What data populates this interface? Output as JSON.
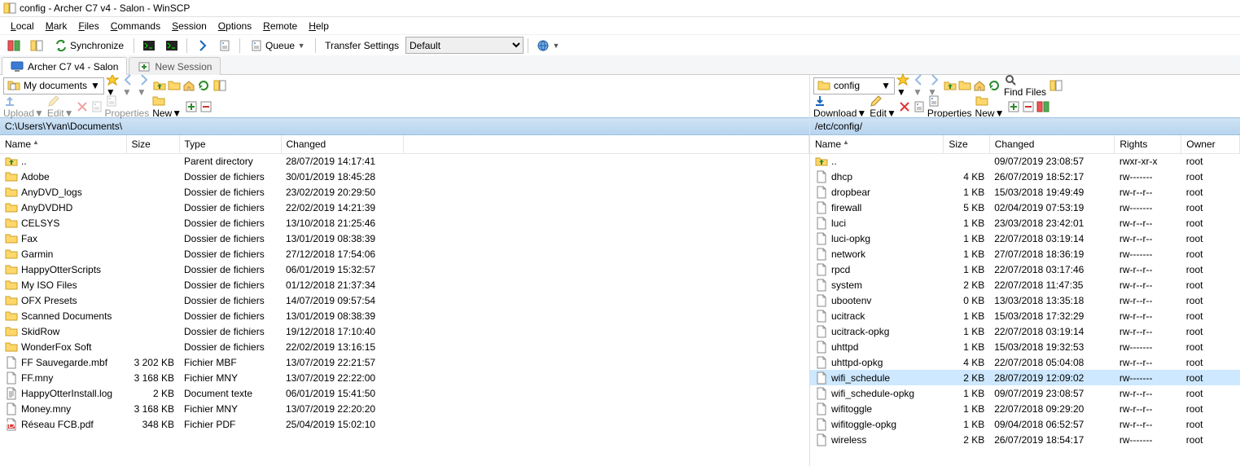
{
  "window_title": "config - Archer C7 v4 - Salon - WinSCP",
  "menu": [
    "Local",
    "Mark",
    "Files",
    "Commands",
    "Session",
    "Options",
    "Remote",
    "Help"
  ],
  "toolbar": {
    "synchronize": "Synchronize",
    "queue": "Queue",
    "transfer_label": "Transfer Settings",
    "transfer_value": "Default"
  },
  "tabs": {
    "session": "Archer C7 v4 - Salon",
    "new": "New Session"
  },
  "left": {
    "drive_label": "My documents",
    "actions": {
      "upload": "Upload",
      "edit": "Edit",
      "properties": "Properties",
      "new": "New"
    },
    "path": "C:\\Users\\Yvan\\Documents\\",
    "cols": [
      "Name",
      "Size",
      "Type",
      "Changed"
    ],
    "rows": [
      {
        "icon": "up",
        "name": "..",
        "size": "",
        "type": "Parent directory",
        "changed": "28/07/2019  14:17:41"
      },
      {
        "icon": "folder",
        "name": "Adobe",
        "size": "",
        "type": "Dossier de fichiers",
        "changed": "30/01/2019  18:45:28"
      },
      {
        "icon": "folder",
        "name": "AnyDVD_logs",
        "size": "",
        "type": "Dossier de fichiers",
        "changed": "23/02/2019  20:29:50"
      },
      {
        "icon": "folder",
        "name": "AnyDVDHD",
        "size": "",
        "type": "Dossier de fichiers",
        "changed": "22/02/2019  14:21:39"
      },
      {
        "icon": "folder",
        "name": "CELSYS",
        "size": "",
        "type": "Dossier de fichiers",
        "changed": "13/10/2018  21:25:46"
      },
      {
        "icon": "folder",
        "name": "Fax",
        "size": "",
        "type": "Dossier de fichiers",
        "changed": "13/01/2019  08:38:39"
      },
      {
        "icon": "folder",
        "name": "Garmin",
        "size": "",
        "type": "Dossier de fichiers",
        "changed": "27/12/2018  17:54:06"
      },
      {
        "icon": "folder",
        "name": "HappyOtterScripts",
        "size": "",
        "type": "Dossier de fichiers",
        "changed": "06/01/2019  15:32:57"
      },
      {
        "icon": "folder",
        "name": "My ISO Files",
        "size": "",
        "type": "Dossier de fichiers",
        "changed": "01/12/2018  21:37:34"
      },
      {
        "icon": "folder",
        "name": "OFX Presets",
        "size": "",
        "type": "Dossier de fichiers",
        "changed": "14/07/2019  09:57:54"
      },
      {
        "icon": "folder",
        "name": "Scanned Documents",
        "size": "",
        "type": "Dossier de fichiers",
        "changed": "13/01/2019  08:38:39"
      },
      {
        "icon": "folder",
        "name": "SkidRow",
        "size": "",
        "type": "Dossier de fichiers",
        "changed": "19/12/2018  17:10:40"
      },
      {
        "icon": "folder",
        "name": "WonderFox Soft",
        "size": "",
        "type": "Dossier de fichiers",
        "changed": "22/02/2019  13:16:15"
      },
      {
        "icon": "file",
        "name": "FF Sauvegarde.mbf",
        "size": "3 202 KB",
        "type": "Fichier MBF",
        "changed": "13/07/2019  22:21:57"
      },
      {
        "icon": "file",
        "name": "FF.mny",
        "size": "3 168 KB",
        "type": "Fichier MNY",
        "changed": "13/07/2019  22:22:00"
      },
      {
        "icon": "txt",
        "name": "HappyOtterInstall.log",
        "size": "2 KB",
        "type": "Document texte",
        "changed": "06/01/2019  15:41:50"
      },
      {
        "icon": "file",
        "name": "Money.mny",
        "size": "3 168 KB",
        "type": "Fichier MNY",
        "changed": "13/07/2019  22:20:20"
      },
      {
        "icon": "pdf",
        "name": "Réseau FCB.pdf",
        "size": "348 KB",
        "type": "Fichier PDF",
        "changed": "25/04/2019  15:02:10"
      }
    ]
  },
  "right": {
    "drive_label": "config",
    "find": "Find Files",
    "actions": {
      "download": "Download",
      "edit": "Edit",
      "properties": "Properties",
      "new": "New"
    },
    "path": "/etc/config/",
    "cols": [
      "Name",
      "Size",
      "Changed",
      "Rights",
      "Owner"
    ],
    "selected": "wifi_schedule",
    "rows": [
      {
        "icon": "up",
        "name": "..",
        "size": "",
        "changed": "09/07/2019 23:08:57",
        "rights": "rwxr-xr-x",
        "owner": "root"
      },
      {
        "icon": "file",
        "name": "dhcp",
        "size": "4 KB",
        "changed": "26/07/2019 18:52:17",
        "rights": "rw-------",
        "owner": "root"
      },
      {
        "icon": "file",
        "name": "dropbear",
        "size": "1 KB",
        "changed": "15/03/2018 19:49:49",
        "rights": "rw-r--r--",
        "owner": "root"
      },
      {
        "icon": "file",
        "name": "firewall",
        "size": "5 KB",
        "changed": "02/04/2019 07:53:19",
        "rights": "rw-------",
        "owner": "root"
      },
      {
        "icon": "file",
        "name": "luci",
        "size": "1 KB",
        "changed": "23/03/2018 23:42:01",
        "rights": "rw-r--r--",
        "owner": "root"
      },
      {
        "icon": "file",
        "name": "luci-opkg",
        "size": "1 KB",
        "changed": "22/07/2018 03:19:14",
        "rights": "rw-r--r--",
        "owner": "root"
      },
      {
        "icon": "file",
        "name": "network",
        "size": "1 KB",
        "changed": "27/07/2018 18:36:19",
        "rights": "rw-------",
        "owner": "root"
      },
      {
        "icon": "file",
        "name": "rpcd",
        "size": "1 KB",
        "changed": "22/07/2018 03:17:46",
        "rights": "rw-r--r--",
        "owner": "root"
      },
      {
        "icon": "file",
        "name": "system",
        "size": "2 KB",
        "changed": "22/07/2018 11:47:35",
        "rights": "rw-r--r--",
        "owner": "root"
      },
      {
        "icon": "file",
        "name": "ubootenv",
        "size": "0 KB",
        "changed": "13/03/2018 13:35:18",
        "rights": "rw-r--r--",
        "owner": "root"
      },
      {
        "icon": "file",
        "name": "ucitrack",
        "size": "1 KB",
        "changed": "15/03/2018 17:32:29",
        "rights": "rw-r--r--",
        "owner": "root"
      },
      {
        "icon": "file",
        "name": "ucitrack-opkg",
        "size": "1 KB",
        "changed": "22/07/2018 03:19:14",
        "rights": "rw-r--r--",
        "owner": "root"
      },
      {
        "icon": "file",
        "name": "uhttpd",
        "size": "1 KB",
        "changed": "15/03/2018 19:32:53",
        "rights": "rw-------",
        "owner": "root"
      },
      {
        "icon": "file",
        "name": "uhttpd-opkg",
        "size": "4 KB",
        "changed": "22/07/2018 05:04:08",
        "rights": "rw-r--r--",
        "owner": "root"
      },
      {
        "icon": "file",
        "name": "wifi_schedule",
        "size": "2 KB",
        "changed": "28/07/2019 12:09:02",
        "rights": "rw-------",
        "owner": "root"
      },
      {
        "icon": "file",
        "name": "wifi_schedule-opkg",
        "size": "1 KB",
        "changed": "09/07/2019 23:08:57",
        "rights": "rw-r--r--",
        "owner": "root"
      },
      {
        "icon": "file",
        "name": "wifitoggle",
        "size": "1 KB",
        "changed": "22/07/2018 09:29:20",
        "rights": "rw-r--r--",
        "owner": "root"
      },
      {
        "icon": "file",
        "name": "wifitoggle-opkg",
        "size": "1 KB",
        "changed": "09/04/2018 06:52:57",
        "rights": "rw-r--r--",
        "owner": "root"
      },
      {
        "icon": "file",
        "name": "wireless",
        "size": "2 KB",
        "changed": "26/07/2019 18:54:17",
        "rights": "rw-------",
        "owner": "root"
      }
    ]
  }
}
